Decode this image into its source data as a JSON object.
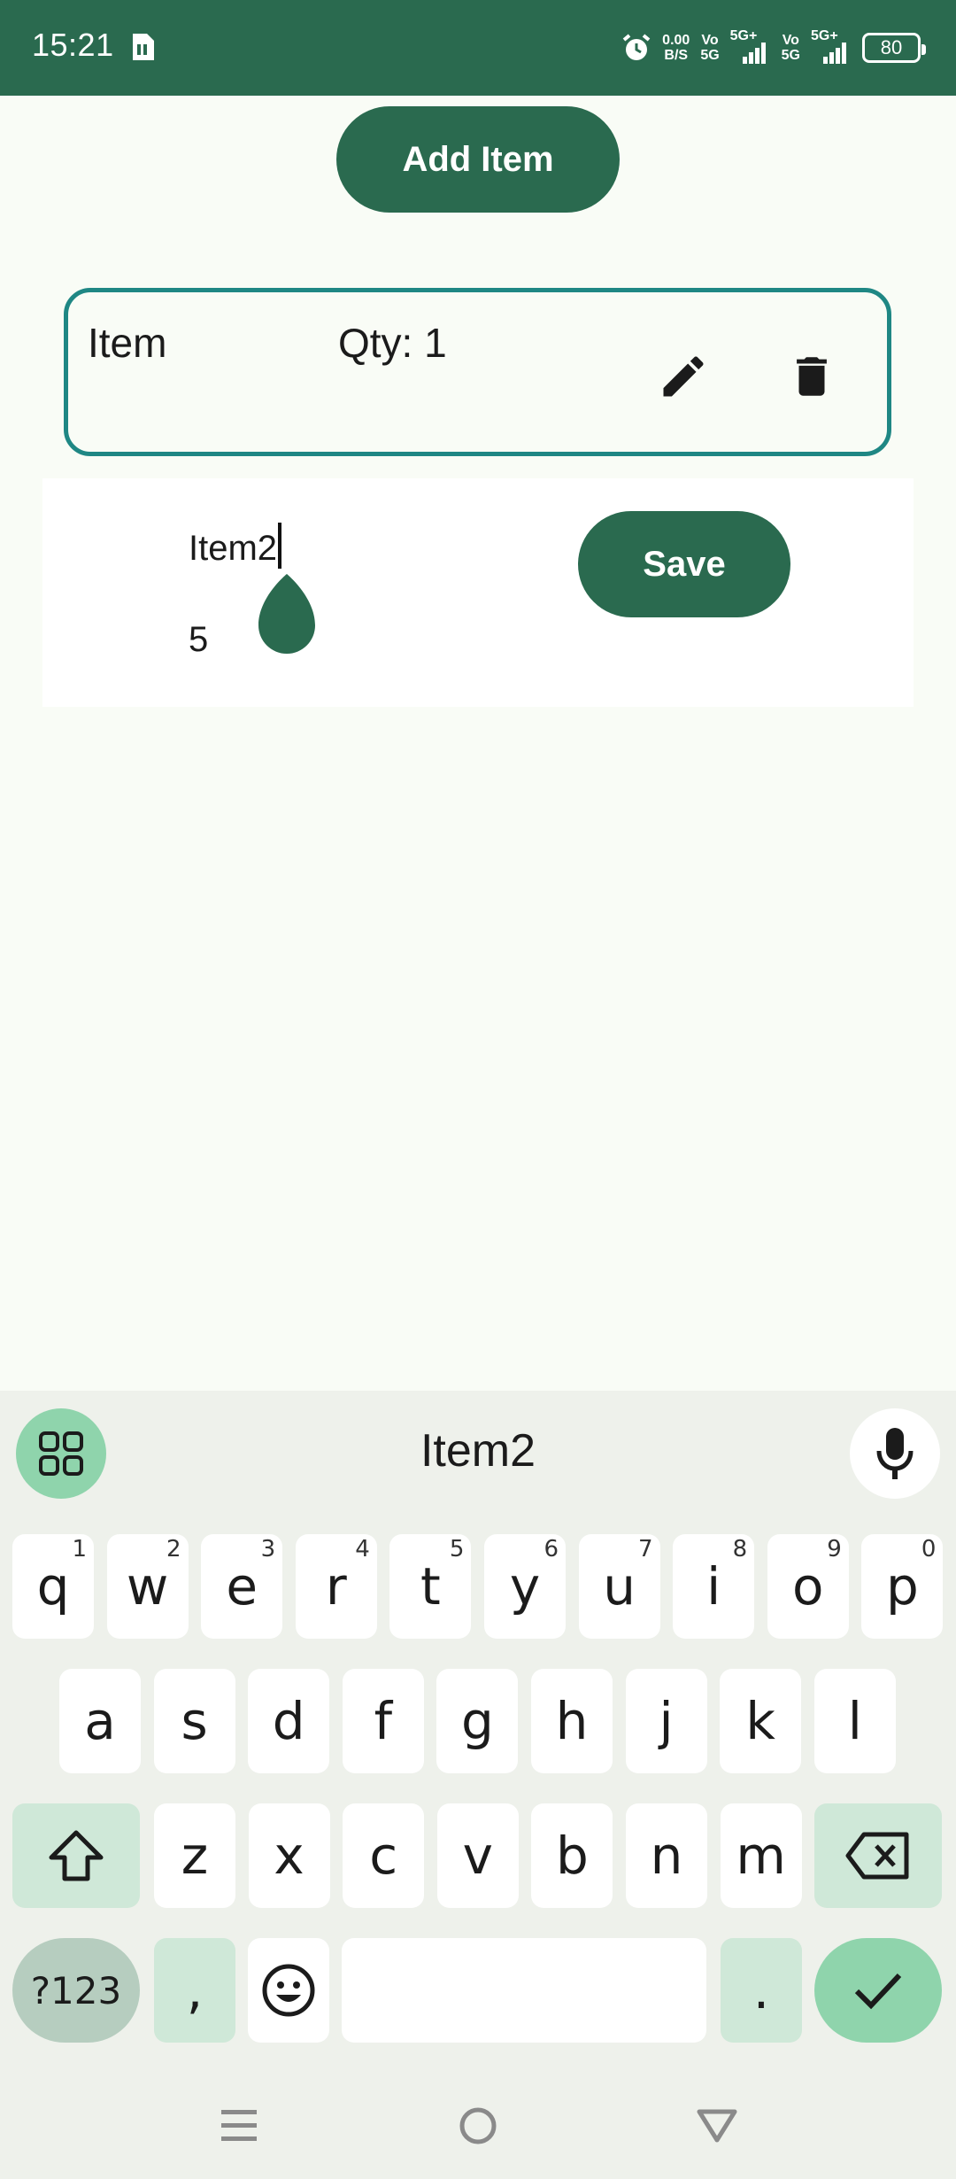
{
  "status_bar": {
    "time": "15:21",
    "net_speed_value": "0.00",
    "net_speed_unit": "B/S",
    "sim1_top": "Vo",
    "sim1_bottom": "5G",
    "sim1_type": "5G+",
    "sim2_top": "Vo",
    "sim2_bottom": "5G",
    "sim2_type": "5G+",
    "battery": "80"
  },
  "main": {
    "add_button_label": "Add Item",
    "item_card": {
      "name": "Item",
      "qty_text": "Qty: 1"
    },
    "edit_panel": {
      "name_value": "Item2",
      "qty_value": "5",
      "save_label": "Save"
    }
  },
  "keyboard": {
    "suggestion": "Item2",
    "row1": [
      {
        "key": "q",
        "hint": "1"
      },
      {
        "key": "w",
        "hint": "2"
      },
      {
        "key": "e",
        "hint": "3"
      },
      {
        "key": "r",
        "hint": "4"
      },
      {
        "key": "t",
        "hint": "5"
      },
      {
        "key": "y",
        "hint": "6"
      },
      {
        "key": "u",
        "hint": "7"
      },
      {
        "key": "i",
        "hint": "8"
      },
      {
        "key": "o",
        "hint": "9"
      },
      {
        "key": "p",
        "hint": "0"
      }
    ],
    "row2": [
      "a",
      "s",
      "d",
      "f",
      "g",
      "h",
      "j",
      "k",
      "l"
    ],
    "row3": [
      "z",
      "x",
      "c",
      "v",
      "b",
      "n",
      "m"
    ],
    "symbols_label": "?123",
    "comma": ",",
    "period": "."
  },
  "colors": {
    "primary": "#2a6a4f",
    "card_border": "#1f8784",
    "background": "#f9fcf6",
    "keyboard_accent": "#8fd4ac"
  }
}
